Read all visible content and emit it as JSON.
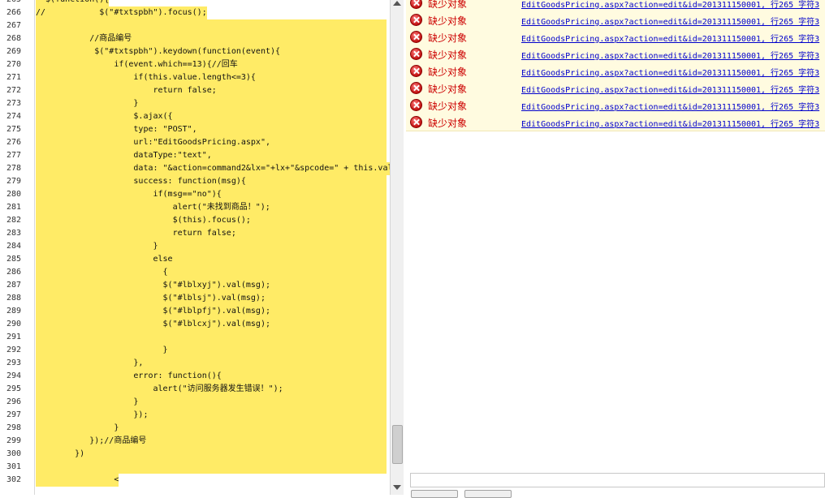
{
  "editor": {
    "lines": [
      {
        "num": "265",
        "text": "  $(function(){"
      },
      {
        "num": "266",
        "text": "//           $(\"#txtspbh\").focus();"
      },
      {
        "num": "267",
        "text": ""
      },
      {
        "num": "268",
        "text": "           //商品编号"
      },
      {
        "num": "269",
        "text": "            $(\"#txtspbh\").keydown(function(event){"
      },
      {
        "num": "270",
        "text": "                if(event.which==13){//回车"
      },
      {
        "num": "271",
        "text": "                    if(this.value.length<=3){"
      },
      {
        "num": "272",
        "text": "                        return false;"
      },
      {
        "num": "273",
        "text": "                    }"
      },
      {
        "num": "274",
        "text": "                    $.ajax({"
      },
      {
        "num": "275",
        "text": "                    type: \"POST\","
      },
      {
        "num": "276",
        "text": "                    url:\"EditGoodsPricing.aspx\","
      },
      {
        "num": "277",
        "text": "                    dataType:\"text\","
      },
      {
        "num": "278",
        "text": "                    data: \"&action=command2&lx=\"+lx+\"&spcode=\" + this.val"
      },
      {
        "num": "279",
        "text": "                    success: function(msg){"
      },
      {
        "num": "280",
        "text": "                        if(msg==\"no\"){"
      },
      {
        "num": "281",
        "text": "                            alert(\"未找到商品！\");"
      },
      {
        "num": "282",
        "text": "                            $(this).focus();"
      },
      {
        "num": "283",
        "text": "                            return false;"
      },
      {
        "num": "284",
        "text": "                        }"
      },
      {
        "num": "285",
        "text": "                        else"
      },
      {
        "num": "286",
        "text": "                          {"
      },
      {
        "num": "287",
        "text": "                          $(\"#lblxyj\").val(msg);"
      },
      {
        "num": "288",
        "text": "                          $(\"#lblsj\").val(msg);"
      },
      {
        "num": "289",
        "text": "                          $(\"#lblpfj\").val(msg);"
      },
      {
        "num": "290",
        "text": "                          $(\"#lblcxj\").val(msg);"
      },
      {
        "num": "291",
        "text": ""
      },
      {
        "num": "292",
        "text": "                          }"
      },
      {
        "num": "293",
        "text": "                    },"
      },
      {
        "num": "294",
        "text": "                    error: function(){"
      },
      {
        "num": "295",
        "text": "                        alert(\"访问服务器发生错误！\");"
      },
      {
        "num": "296",
        "text": "                    }"
      },
      {
        "num": "297",
        "text": "                    });"
      },
      {
        "num": "298",
        "text": "                }"
      },
      {
        "num": "299",
        "text": "           });//商品编号"
      },
      {
        "num": "300",
        "text": "        })"
      },
      {
        "num": "301",
        "text": ""
      },
      {
        "num": "302",
        "text": "                <"
      }
    ]
  },
  "error_list": {
    "rows": [
      {
        "description": "缺少对象",
        "file": "EditGoodsPricing.aspx?action=edit&id=201311150001, 行265 字符3"
      },
      {
        "description": "缺少对象",
        "file": "EditGoodsPricing.aspx?action=edit&id=201311150001, 行265 字符3"
      },
      {
        "description": "缺少对象",
        "file": "EditGoodsPricing.aspx?action=edit&id=201311150001, 行265 字符3"
      },
      {
        "description": "缺少对象",
        "file": "EditGoodsPricing.aspx?action=edit&id=201311150001, 行265 字符3"
      },
      {
        "description": "缺少对象",
        "file": "EditGoodsPricing.aspx?action=edit&id=201311150001, 行265 字符3"
      },
      {
        "description": "缺少对象",
        "file": "EditGoodsPricing.aspx?action=edit&id=201311150001, 行265 字符3"
      },
      {
        "description": "缺少对象",
        "file": "EditGoodsPricing.aspx?action=edit&id=201311150001, 行265 字符3"
      },
      {
        "description": "缺少对象",
        "file": "EditGoodsPricing.aspx?action=edit&id=201311150001, 行265 字符3"
      }
    ]
  },
  "colors": {
    "highlight": "#ffeb66",
    "error_text": "#cc0000",
    "link": "#0000cc"
  },
  "icons": {
    "error": "error-circle-x-icon"
  }
}
